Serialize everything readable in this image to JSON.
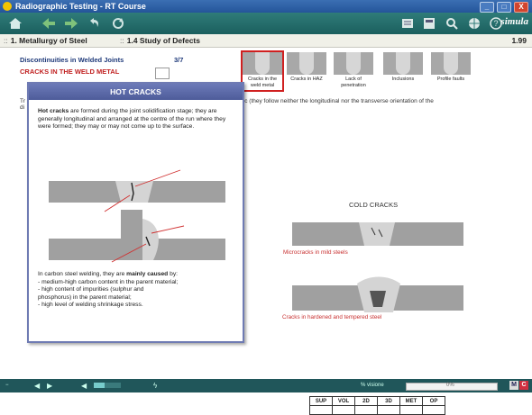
{
  "window": {
    "title": "Radiographic Testing - RT Course",
    "buttons": [
      "_",
      "□",
      "X"
    ]
  },
  "toolbar": {
    "left_icons": [
      "home-icon",
      "back-icon",
      "forward-icon",
      "undo-icon",
      "refresh-icon"
    ],
    "right_icons": [
      "notes-icon",
      "calculator-icon",
      "search-icon",
      "globe-icon",
      "help-icon"
    ],
    "brand": "simula"
  },
  "nav": {
    "chapter": "1. Metallurgy of Steel",
    "section": "1.4 Study of Defects",
    "page": "1.99"
  },
  "page": {
    "subheading": "Discontinuities in Welded Joints",
    "counter": "3/7",
    "section_title": "CRACKS IN THE WELD METAL",
    "body_fragment": "tic (they follow neither the longitudinal nor the transverse orientation of the",
    "edge_letters": [
      "Tr",
      "di"
    ]
  },
  "thumbnails": [
    {
      "label": "Cracks in the weld metal",
      "selected": true
    },
    {
      "label": "Cracks in HAZ",
      "selected": false
    },
    {
      "label": "Lack of penetration",
      "selected": false
    },
    {
      "label": "Inclusions",
      "selected": false
    },
    {
      "label": "Profile faults",
      "selected": false
    }
  ],
  "popup": {
    "title": "HOT CRACKS",
    "intro_bold": "Hot cracks",
    "intro_rest": " are formed during the joint solidification stage; they are generally longitudinal and arranged at the centre of the run where they were formed; they may or may not come up to the surface.",
    "cause_prefix": "In carbon steel welding, they are ",
    "cause_bold": "mainly caused",
    "cause_suffix": " by:",
    "causes": [
      "- medium-high carbon content in the parent material;",
      "- high content of impurities (sulphur and",
      "  phosphorus) in the parent material;",
      "- high level of welding shrinkage stress."
    ]
  },
  "cold": {
    "title": "COLD CRACKS",
    "label_mild": "Microcracks in mild steels",
    "label_hardened": "Cracks in hardened and tempered steel"
  },
  "codes": [
    "SUP",
    "VOL",
    "2D",
    "3D",
    "MET",
    "OP"
  ],
  "status": {
    "progress_label": "% visione",
    "progress_value": "0%",
    "progress_fraction": 0.0,
    "badges": [
      "M",
      "C"
    ]
  },
  "colors": {
    "accent": "#1b5f5e",
    "popup_header": "#5b68a8",
    "red_label": "#c83030",
    "weld_grey": "#a0a0a0"
  }
}
